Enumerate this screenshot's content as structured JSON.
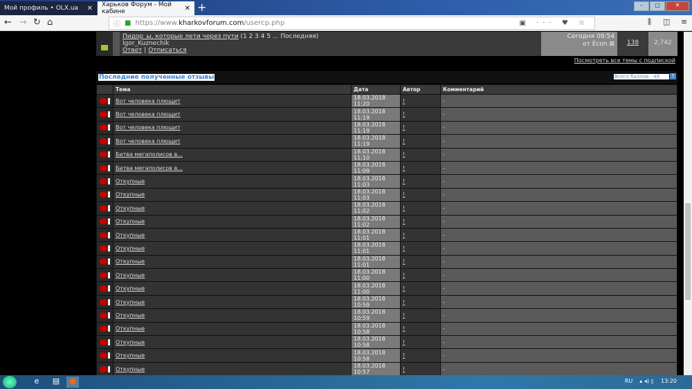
{
  "browser": {
    "tabs": [
      {
        "label": "Мой профиль • OLX.ua"
      },
      {
        "label": "Харьков Форум - Мой кабине"
      }
    ],
    "url_prefix": "https://www.",
    "url_host": "kharkovforum.com",
    "url_path": "/usercp.php"
  },
  "subscribed_thread": {
    "title": "Пидор_ы, которые лети через пути",
    "pages": "(1 2 3 4 5 ... Последняя)",
    "starter": "Igor_Kuznechik",
    "reply": "Ответ",
    "unsubscribe": "Отписаться",
    "last_post_time": "Сегодня 09:54",
    "last_post_by": "от Econ",
    "replies": "138",
    "views": "2,742"
  },
  "view_all_link": "Посмотреть все темы с подпиской",
  "feedback": {
    "title": "Последние полученные отзывы",
    "total_points": "Всего баллов: -49",
    "help": "?",
    "columns": [
      "Тема",
      "Дата",
      "Автор",
      "Комментарий"
    ],
    "rows": [
      {
        "topic": "Вот человека плющит",
        "date": "18.03.2018 11:20",
        "author": "!",
        "comment": "-"
      },
      {
        "topic": "Вот человека плющит",
        "date": "18.03.2018 11:19",
        "author": "!",
        "comment": "-"
      },
      {
        "topic": "Вот человека плющит",
        "date": "18.03.2018 11:19",
        "author": "!",
        "comment": "-"
      },
      {
        "topic": "Вот человека плющит",
        "date": "18.03.2018 11:19",
        "author": "!",
        "comment": "-"
      },
      {
        "topic": "Битва мегаполисов в...",
        "date": "18.03.2018 11:10",
        "author": "!",
        "comment": "-"
      },
      {
        "topic": "Битва мегаполисов в...",
        "date": "18.03.2018 11:09",
        "author": "!",
        "comment": "-"
      },
      {
        "topic": "Откупные",
        "date": "18.03.2018 11:03",
        "author": "!",
        "comment": "-"
      },
      {
        "topic": "Откупные",
        "date": "18.03.2018 11:03",
        "author": "!",
        "comment": "-"
      },
      {
        "topic": "Откупные",
        "date": "18.03.2018 11:02",
        "author": "!",
        "comment": "-"
      },
      {
        "topic": "Откупные",
        "date": "18.03.2018 11:02",
        "author": "!",
        "comment": "-"
      },
      {
        "topic": "Откупные",
        "date": "18.03.2018 11:01",
        "author": "!",
        "comment": "-"
      },
      {
        "topic": "Откупные",
        "date": "18.03.2018 11:01",
        "author": "!",
        "comment": "-"
      },
      {
        "topic": "Откупные",
        "date": "18.03.2018 11:01",
        "author": "!",
        "comment": "-"
      },
      {
        "topic": "Откупные",
        "date": "18.03.2018 11:00",
        "author": "!",
        "comment": "-"
      },
      {
        "topic": "Откупные",
        "date": "18.03.2018 11:00",
        "author": "!",
        "comment": "-"
      },
      {
        "topic": "Откупные",
        "date": "18.03.2018 10:59",
        "author": "!",
        "comment": "-"
      },
      {
        "topic": "Откупные",
        "date": "18.03.2018 10:59",
        "author": "!",
        "comment": "-"
      },
      {
        "topic": "Откупные",
        "date": "18.03.2018 10:58",
        "author": "!",
        "comment": "-"
      },
      {
        "topic": "Откупные",
        "date": "18.03.2018 10:58",
        "author": "!",
        "comment": "-"
      },
      {
        "topic": "Откупные",
        "date": "18.03.2018 10:58",
        "author": "!",
        "comment": "-"
      },
      {
        "topic": "Откупные",
        "date": "18.03.2018 10:57",
        "author": "!",
        "comment": "-"
      }
    ]
  },
  "taskbar": {
    "lang": "RU",
    "time": "13:20"
  }
}
